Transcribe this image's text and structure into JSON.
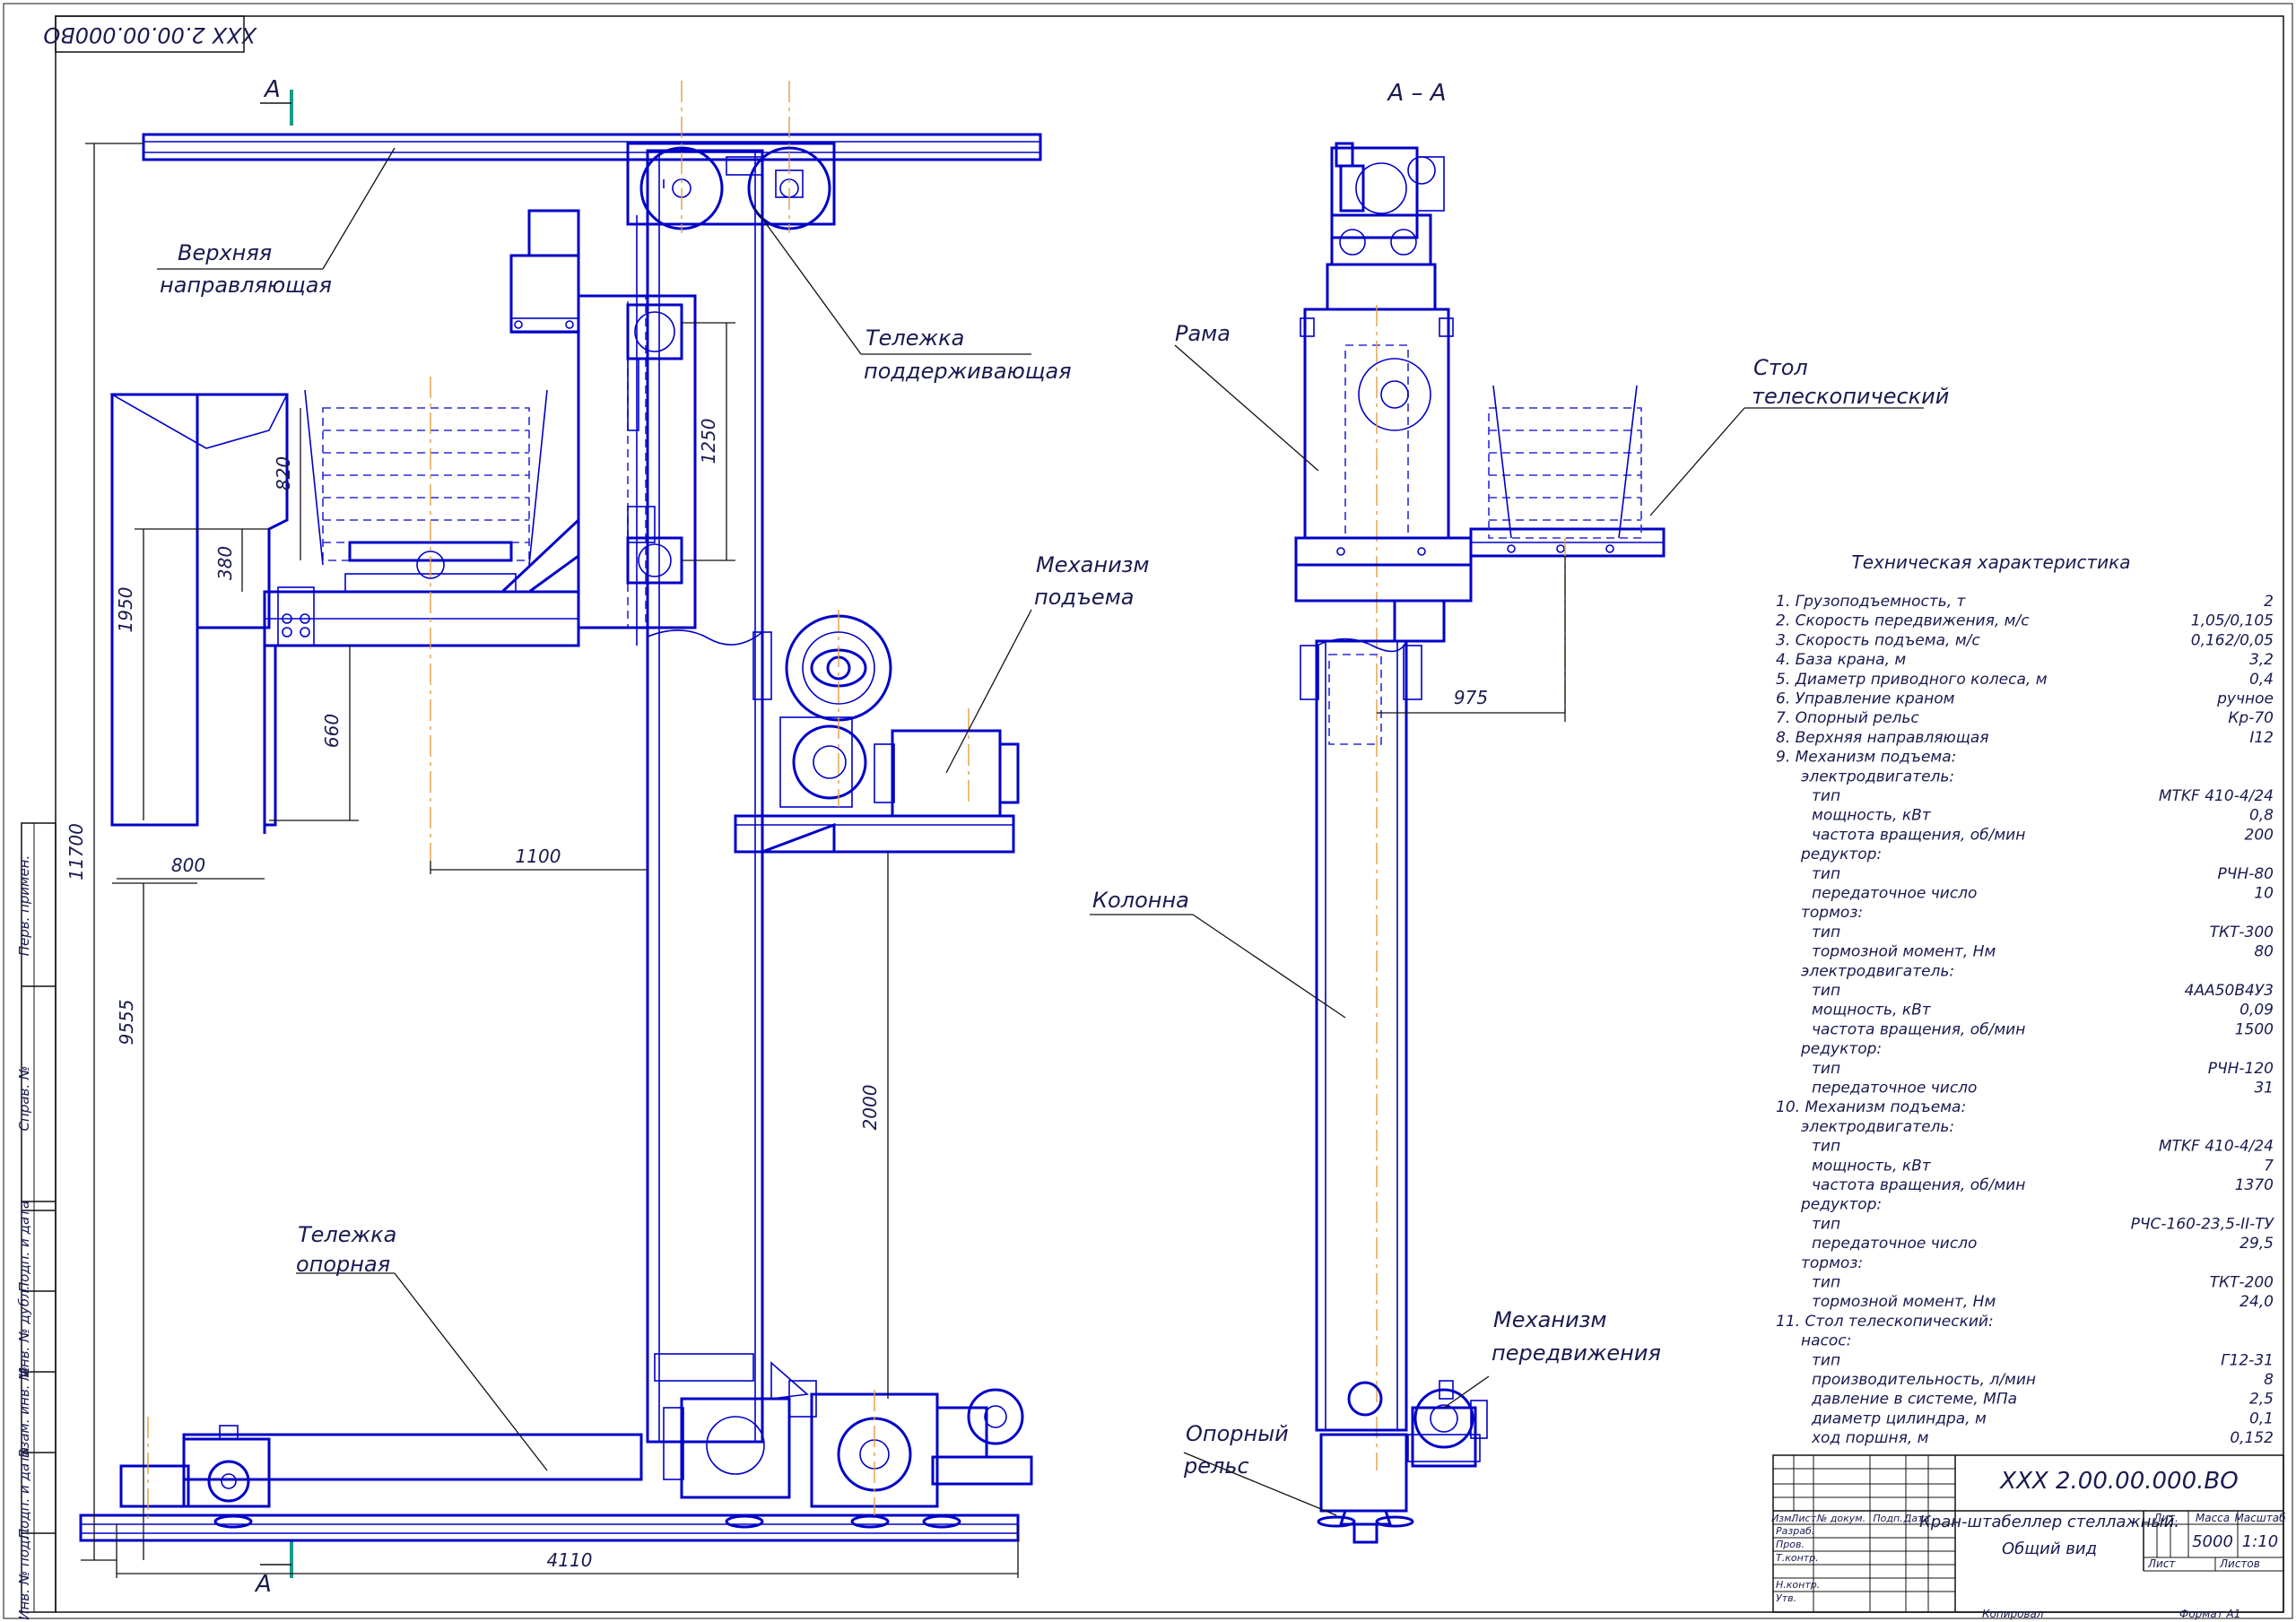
{
  "drawing_code_corner": "XXX 2.00.00.000ВО",
  "section_mark": "А",
  "section_title": "А – А",
  "labels": {
    "upper_guide": [
      "Верхняя",
      "направляющая"
    ],
    "support_trolley": [
      "Тележка",
      "поддерживающая"
    ],
    "lift_mechanism": [
      "Механизм",
      "подъема"
    ],
    "base_trolley": [
      "Тележка",
      "опорная"
    ],
    "frame": [
      "Рама"
    ],
    "telescopic_table": [
      "Стол",
      "телескопический"
    ],
    "column": [
      "Колонна"
    ],
    "travel_mechanism": [
      "Механизм",
      "передвижения"
    ],
    "support_rail": [
      "Опорный",
      "рельс"
    ]
  },
  "dimensions": {
    "d11700": "11700",
    "d9555": "9555",
    "d1950": "1950",
    "d820": "820",
    "d380": "380",
    "d660": "660",
    "d800": "800",
    "d1100": "1100",
    "d1250": "1250",
    "d2000": "2000",
    "d4110": "4110",
    "d975": "975"
  },
  "tech_spec": {
    "title": "Техническая характеристика",
    "rows": [
      {
        "label": "1. Грузоподъемность, т",
        "value": "2",
        "indent": 0
      },
      {
        "label": "2. Скорость передвижения, м/с",
        "value": "1,05/0,105",
        "indent": 0
      },
      {
        "label": "3. Скорость подъема, м/с",
        "value": "0,162/0,05",
        "indent": 0
      },
      {
        "label": "4. База крана, м",
        "value": "3,2",
        "indent": 0
      },
      {
        "label": "5. Диаметр приводного колеса, м",
        "value": "0,4",
        "indent": 0
      },
      {
        "label": "6. Управление краном",
        "value": "ручное",
        "indent": 0
      },
      {
        "label": "7. Опорный рельс",
        "value": "Кр-70",
        "indent": 0
      },
      {
        "label": "8. Верхняя направляющая",
        "value": "I12",
        "indent": 0
      },
      {
        "label": "9. Механизм подъема:",
        "value": "",
        "indent": 0
      },
      {
        "label": "электродвигатель:",
        "value": "",
        "indent": 1
      },
      {
        "label": "тип",
        "value": "MTKF 410-4/24",
        "indent": 2
      },
      {
        "label": "мощность, кВт",
        "value": "0,8",
        "indent": 2
      },
      {
        "label": "частота вращения, об/мин",
        "value": "200",
        "indent": 2
      },
      {
        "label": "редуктор:",
        "value": "",
        "indent": 1
      },
      {
        "label": "тип",
        "value": "РЧН-80",
        "indent": 2
      },
      {
        "label": "передаточное число",
        "value": "10",
        "indent": 2
      },
      {
        "label": "тормоз:",
        "value": "",
        "indent": 1
      },
      {
        "label": "тип",
        "value": "ТКТ-300",
        "indent": 2
      },
      {
        "label": "тормозной момент, Нм",
        "value": "80",
        "indent": 2
      },
      {
        "label": "электродвигатель:",
        "value": "",
        "indent": 1
      },
      {
        "label": "тип",
        "value": "4АА50В4У3",
        "indent": 2
      },
      {
        "label": "мощность, кВт",
        "value": "0,09",
        "indent": 2
      },
      {
        "label": "частота вращения, об/мин",
        "value": "1500",
        "indent": 2
      },
      {
        "label": "редуктор:",
        "value": "",
        "indent": 1
      },
      {
        "label": "тип",
        "value": "РЧН-120",
        "indent": 2
      },
      {
        "label": "передаточное число",
        "value": "31",
        "indent": 2
      },
      {
        "label": "10. Механизм подъема:",
        "value": "",
        "indent": 0
      },
      {
        "label": "электродвигатель:",
        "value": "",
        "indent": 1
      },
      {
        "label": "тип",
        "value": "MTKF 410-4/24",
        "indent": 2
      },
      {
        "label": "мощность, кВт",
        "value": "7",
        "indent": 2
      },
      {
        "label": "частота вращения, об/мин",
        "value": "1370",
        "indent": 2
      },
      {
        "label": "редуктор:",
        "value": "",
        "indent": 1
      },
      {
        "label": "тип",
        "value": "РЧС-160-23,5-II-ТУ",
        "indent": 2
      },
      {
        "label": "передаточное число",
        "value": "29,5",
        "indent": 2
      },
      {
        "label": "тормоз:",
        "value": "",
        "indent": 1
      },
      {
        "label": "тип",
        "value": "ТКТ-200",
        "indent": 2
      },
      {
        "label": "тормозной момент, Нм",
        "value": "24,0",
        "indent": 2
      },
      {
        "label": "11. Стол телескопический:",
        "value": "",
        "indent": 0
      },
      {
        "label": "насос:",
        "value": "",
        "indent": 1
      },
      {
        "label": "тип",
        "value": "Г12-31",
        "indent": 2
      },
      {
        "label": "производительность, л/мин",
        "value": "8",
        "indent": 2
      },
      {
        "label": "давление в системе, МПа",
        "value": "2,5",
        "indent": 2
      },
      {
        "label": "диаметр цилиндра, м",
        "value": "0,1",
        "indent": 2
      },
      {
        "label": "ход поршня, м",
        "value": "0,152",
        "indent": 2
      }
    ]
  },
  "title_block": {
    "code": "XXX 2.00.00.000.ВО",
    "name_line1": "Кран-штабеллер стеллажный.",
    "name_line2": "Общий вид",
    "col_izm": "Изм.",
    "col_list": "Лист",
    "col_doc": "№ докум.",
    "col_sign": "Подп.",
    "col_date": "Дата",
    "row_razrab": "Разраб.",
    "row_prov": "Пров.",
    "row_tkontr": "Т.контр.",
    "row_nkontr": "Н.контр.",
    "row_utv": "Утв.",
    "hdr_lit": "Лит.",
    "hdr_mass": "Масса",
    "hdr_scale": "Масштаб",
    "mass": "5000",
    "scale": "1:10",
    "sheet_label": "Лист",
    "sheets_label": "Листов",
    "copied": "Копировал",
    "format": "Формат   А1"
  },
  "side_stamp": [
    "Перв. примен.",
    "Справ. №",
    "Подп. и дата",
    "Инв. № дубл.",
    "Взам. инв. №",
    "Подп. и дата",
    "Инв. № подл."
  ]
}
